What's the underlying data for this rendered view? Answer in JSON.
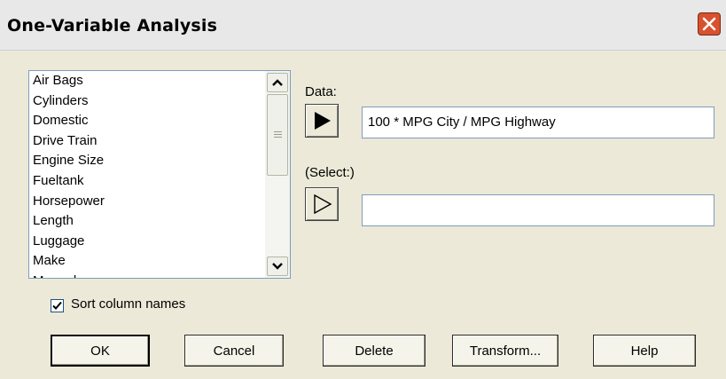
{
  "window": {
    "title": "One-Variable Analysis"
  },
  "columns_list": {
    "items": [
      "Air Bags",
      "Cylinders",
      "Domestic",
      "Drive Train",
      "Engine Size",
      "Fueltank",
      "Horsepower",
      "Length",
      "Luggage",
      "Make",
      "Manual"
    ]
  },
  "data_field": {
    "label": "Data:",
    "value": "100 * MPG City / MPG Highway"
  },
  "select_field": {
    "label": "(Select:)",
    "value": ""
  },
  "sort_option": {
    "label": "Sort column names",
    "checked": true
  },
  "buttons": {
    "ok": "OK",
    "cancel": "Cancel",
    "delete": "Delete",
    "transform": "Transform...",
    "help": "Help"
  },
  "icons": {
    "close": "close-icon",
    "scroll_up": "chevron-up-icon",
    "scroll_down": "chevron-down-icon",
    "data_arrow": "play-arrow-icon",
    "select_arrow": "outline-arrow-icon"
  },
  "colors": {
    "close_button": "#d8512f",
    "dialog_bg": "#ece9d8"
  }
}
